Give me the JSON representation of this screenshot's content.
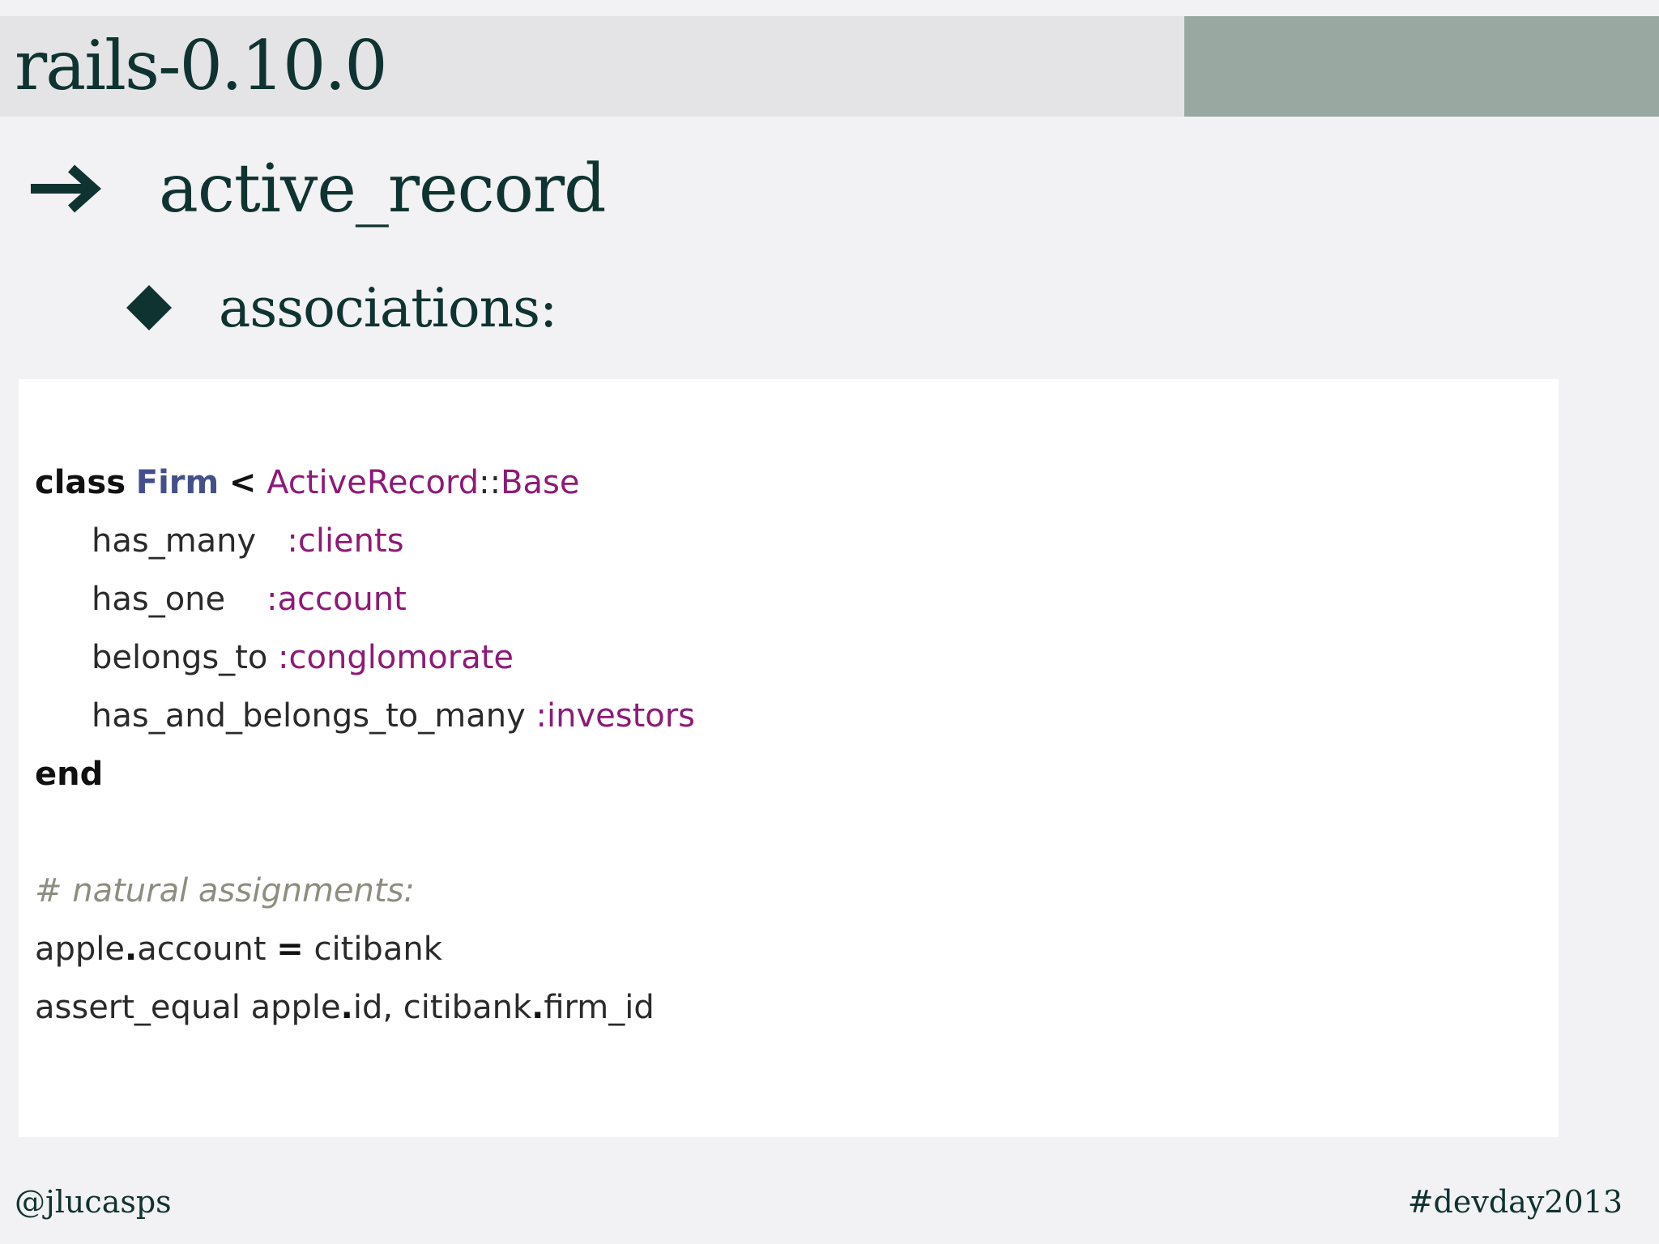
{
  "slide": {
    "title": "rails-0.10.0",
    "bullet_1": "active_record",
    "bullet_2": "associations:"
  },
  "icons": {
    "bullet_1": "arrow-right-icon",
    "bullet_2": "diamond-icon"
  },
  "code": {
    "line_1": {
      "kw_class": "class",
      "class_name": "Firm",
      "op_lt": "<",
      "const_ar": "ActiveRecord",
      "op_scope": "::",
      "const_base": "Base"
    },
    "line_2": {
      "method": "has_many",
      "symbol": ":clients"
    },
    "line_3": {
      "method": "has_one",
      "symbol": ":account"
    },
    "line_4": {
      "method": "belongs_to",
      "symbol": ":conglomorate"
    },
    "line_5": {
      "method": "has_and_belongs_to_many",
      "symbol": ":investors"
    },
    "line_6": {
      "kw_end": "end"
    },
    "line_7": {
      "comment": "# natural assignments:"
    },
    "line_8": {
      "obj": "apple",
      "dot": ".",
      "attr": "account",
      "op_eq": "=",
      "value": "citibank"
    },
    "line_9": {
      "method": "assert_equal",
      "obj1": "apple",
      "dot1": ".",
      "attr1": "id,",
      "obj2": "citibank",
      "dot2": ".",
      "attr2": "firm_id"
    }
  },
  "footer": {
    "handle": "@jlucasps",
    "hashtag": "#devday2013"
  },
  "colors": {
    "title_text": "#0f3330",
    "title_bar": "#e4e4e6",
    "title_accent": "#9aa8a2",
    "background": "#f2f1f3",
    "code_background": "#ffffff",
    "class_name": "#45508a",
    "symbol": "#8d1a78",
    "comment": "#8d8d80"
  }
}
